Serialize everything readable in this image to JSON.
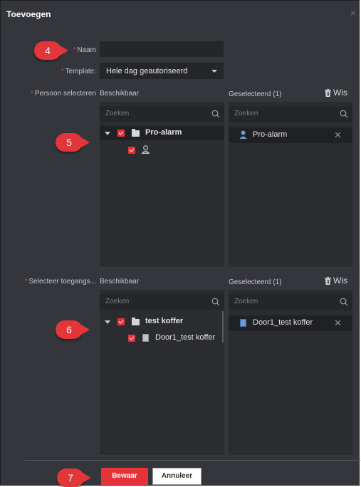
{
  "dialog": {
    "title": "Toevoegen",
    "close_glyph": "×"
  },
  "form": {
    "name": {
      "label": "Naam",
      "value": ""
    },
    "template": {
      "label": "Template:",
      "value": "Hele dag geautoriseerd"
    }
  },
  "person": {
    "label": "Persoon selecteren",
    "available": {
      "header": "Beschikbaar",
      "search_placeholder": "Zoeken",
      "tree": [
        {
          "name": "Pro-alarm",
          "type": "group",
          "checked": true,
          "expanded": true
        },
        {
          "name": "",
          "type": "person",
          "checked": true
        }
      ]
    },
    "selected": {
      "header": "Geselecteerd  (1)",
      "clear_label": "Wis",
      "search_placeholder": "Zoeken",
      "items": [
        {
          "name": "Pro-alarm",
          "icon": "person-icon"
        }
      ]
    }
  },
  "access": {
    "label": "Selecteer toegangs...",
    "available": {
      "header": "Beschikbaar",
      "search_placeholder": "Zoeken",
      "tree": [
        {
          "name": "test koffer",
          "type": "group",
          "checked": true,
          "expanded": true
        },
        {
          "name": "Door1_test koffer",
          "type": "door",
          "checked": true
        }
      ]
    },
    "selected": {
      "header": "Geselecteerd  (1)",
      "clear_label": "Wis",
      "search_placeholder": "Zoeken",
      "items": [
        {
          "name": "Door1_test koffer",
          "icon": "door-icon"
        }
      ]
    }
  },
  "buttons": {
    "save": "Bewaar",
    "cancel": "Annuleer"
  },
  "callouts": [
    "4",
    "5",
    "6",
    "7"
  ],
  "colors": {
    "accent": "#e8323a",
    "callout": "#e2363b",
    "dialog_bg": "#35363b",
    "panel_bg": "#2b2c30"
  }
}
